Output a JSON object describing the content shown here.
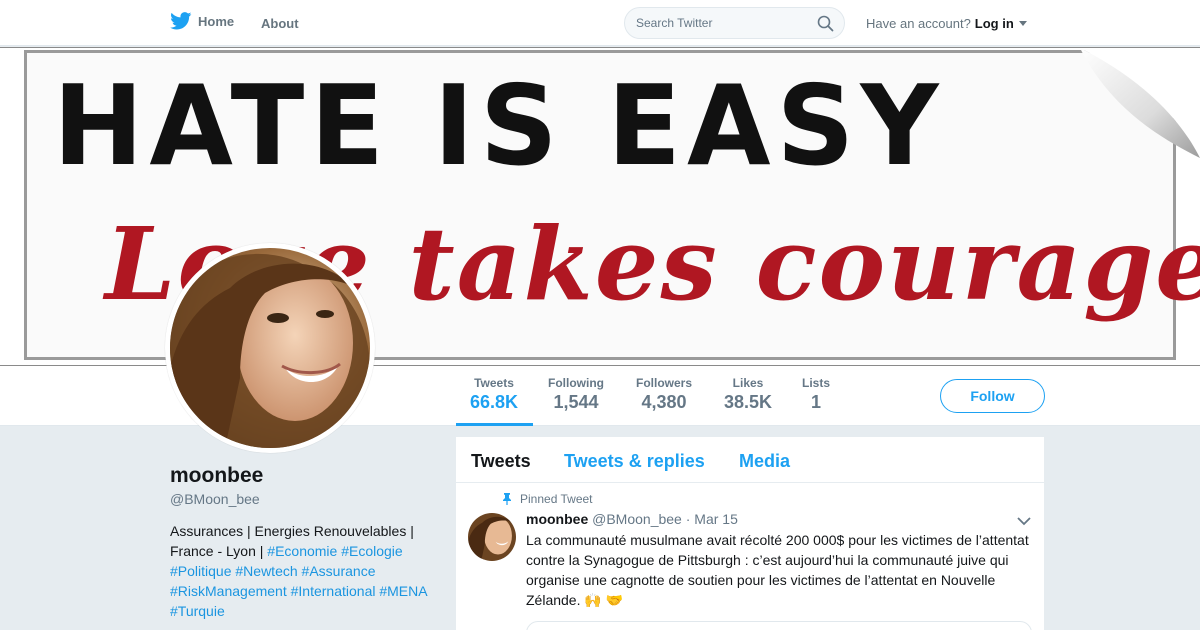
{
  "nav": {
    "home_label": "Home",
    "about_label": "About",
    "search_placeholder": "Search Twitter",
    "account_prompt": "Have an account?",
    "login_label": "Log in"
  },
  "banner": {
    "line1": "HATE IS EASY",
    "line2": "Love takes courage."
  },
  "stats": [
    {
      "label": "Tweets",
      "value": "66.8K"
    },
    {
      "label": "Following",
      "value": "1,544"
    },
    {
      "label": "Followers",
      "value": "4,380"
    },
    {
      "label": "Likes",
      "value": "38.5K"
    },
    {
      "label": "Lists",
      "value": "1"
    }
  ],
  "follow_label": "Follow",
  "profile": {
    "name": "moonbee",
    "handle": "@BMoon_bee",
    "bio_text": "Assurances | Energies Renouvelables | France - Lyon |",
    "bio_tags": [
      "#Economie",
      "#Ecologie",
      "#Politique",
      "#Newtech",
      "#Assurance",
      "#RiskManagement",
      "#International",
      "#MENA",
      "#Turquie"
    ]
  },
  "timeline": {
    "tabs": [
      "Tweets",
      "Tweets & replies",
      "Media"
    ],
    "pinned_label": "Pinned Tweet",
    "tweet": {
      "name": "moonbee",
      "handle": "@BMoon_bee",
      "sep": "·",
      "date": "Mar 15",
      "text": "La communauté musulmane avait récolté 200 000$ pour les victimes de l’attentat contre la Synagogue de Pittsburgh : c’est aujourd’hui la communauté juive  qui organise une cagnotte de soutien pour les victimes de l’attentat en Nouvelle Zélande. 🙌    🤝"
    }
  },
  "colors": {
    "accent": "#1da1f2",
    "banner_red": "#b01722",
    "page_bg": "#e6ecf0"
  }
}
